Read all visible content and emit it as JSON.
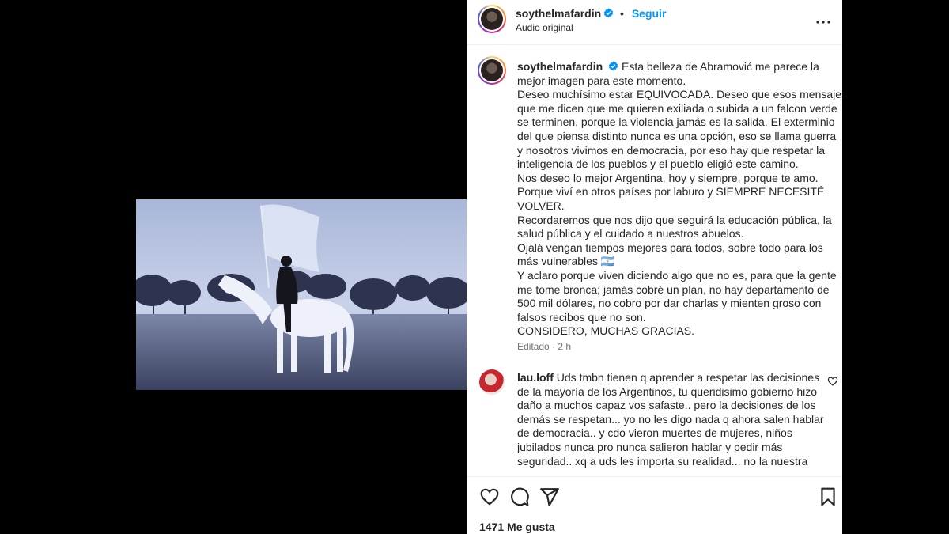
{
  "post": {
    "username": "soythelmafardin",
    "follow_label": "Seguir",
    "separator": "•",
    "audio_label": "Audio original"
  },
  "caption": {
    "username": "soythelmafardin",
    "lines": [
      "Esta belleza de Abramović me parece la",
      "mejor imagen para este momento.",
      "Deseo muchísimo estar EQUIVOCADA. Deseo que esos mensajes",
      "que me dicen que me quieren exiliada o subida a un falcon verde",
      "se terminen, porque la violencia jamás es la salida. El exterminio",
      "del que piensa distinto nunca es una opción, eso se llama guerra",
      "y nosotros vivimos en democracia, por eso hay que respetar la",
      "inteligencia de los pueblos y el pueblo eligió este camino.",
      "Nos deseo lo mejor Argentina, hoy y siempre, porque te amo.",
      "Porque viví en otros países por laburo y SIEMPRE NECESITÉ",
      "VOLVER.",
      "Recordaremos que nos dijo que seguirá la educación pública, la",
      "salud pública y el cuidado a nuestros abuelos.",
      "Ojalá vengan tiempos mejores para todos, sobre todo para los",
      "más vulnerables 🇦🇷",
      "Y aclaro porque viven diciendo algo que no es, para que la gente",
      "me tome bronca; jamás cobré un plan, no hay departamento de",
      "500 mil dólares, no cobro por dar charlas y mienten groso con",
      "falsos recibos que no son.",
      "CONSIDERO, MUCHAS GRACIAS."
    ],
    "meta": "Editado · 2 h"
  },
  "comment": {
    "username": "lau.loff",
    "lines": [
      "Uds tmbn tienen q aprender a respetar las decisiones",
      "de la mayoría de los Argentinos, tu queridisimo gobierno hizo",
      "daño a muchos capaz vos safaste.. pero la decisiones de los",
      "demás se respetan... yo no les digo nada q ahora salen hablar",
      "de democracia.. y cdo vieron muertes de mujeres, niños",
      "jubilados nunca pro nunca salieron hablar y pedir más",
      "seguridad.. xq a uds les importa su realidad... no la nuestra"
    ]
  },
  "actions": {
    "likes": "1471 Me gusta"
  },
  "icons": {
    "verified": "verified-badge-icon",
    "more": "more-options-icon",
    "like": "heart-icon",
    "comment": "comment-icon",
    "share": "send-icon",
    "save": "bookmark-icon"
  },
  "colors": {
    "accent": "#0095f6",
    "text": "#262626",
    "muted": "#737373"
  }
}
